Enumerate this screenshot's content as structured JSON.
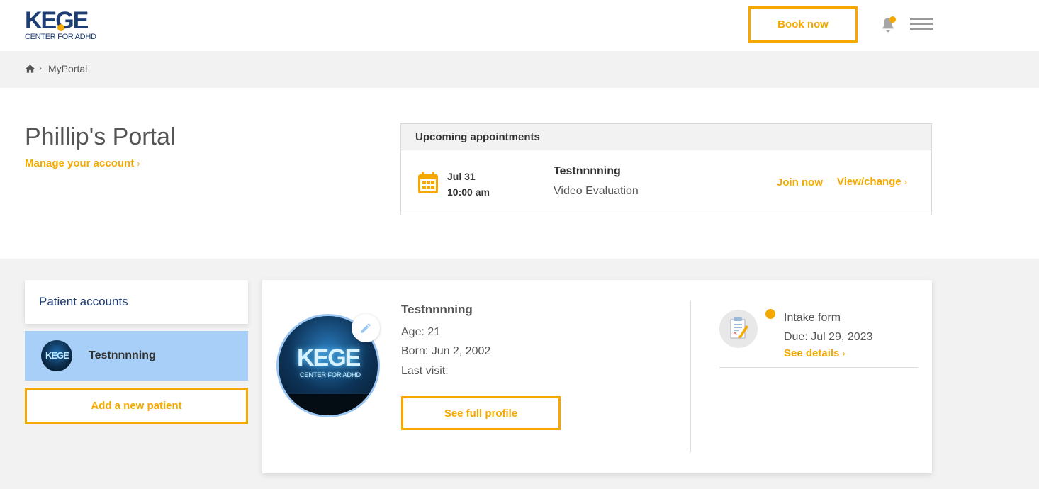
{
  "header": {
    "logo_text": "KEGE",
    "logo_subtitle": "CENTER FOR ADHD",
    "book_label": "Book now",
    "bell_icon": "bell-icon",
    "menu_icon": "hamburger-menu-icon"
  },
  "breadcrumb": {
    "home_icon": "home-icon",
    "separator": "›",
    "current": "MyPortal"
  },
  "portal": {
    "title": "Phillip's Portal",
    "manage_link": "Manage your account",
    "chevron": "›"
  },
  "appointments": {
    "heading": "Upcoming appointments",
    "items": [
      {
        "date": "Jul 31",
        "time": "10:00 am",
        "patient": "Testnnnning",
        "type": "Video Evaluation",
        "join_label": "Join now",
        "view_label": "View/change"
      }
    ]
  },
  "patients": {
    "heading": "Patient accounts",
    "list": [
      {
        "name": "Testnnnning",
        "avatar_text": "KEGE"
      }
    ],
    "add_label": "Add a new patient"
  },
  "profile": {
    "name": "Testnnnning",
    "age": "Age: 21",
    "born": "Born: Jun 2, 2002",
    "last_visit": "Last visit:",
    "full_profile_label": "See full profile",
    "avatar_text": "KEGE",
    "avatar_subtext": "CENTER FOR ADHD"
  },
  "tasks": [
    {
      "title": "Intake form",
      "due": "Due: Jul 29, 2023",
      "link": "See details"
    }
  ],
  "colors": {
    "accent": "#f5a800",
    "brand": "#1d3d74",
    "selected_row": "#a8cff8"
  }
}
